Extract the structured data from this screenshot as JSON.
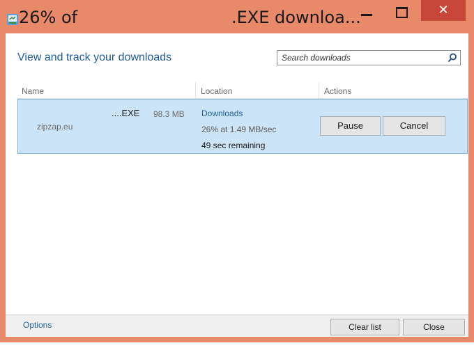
{
  "window": {
    "title_left": "26% of",
    "title_right": ".EXE downloa...",
    "close_glyph": "✕",
    "accent_color": "#e8896a",
    "close_color": "#c7483a"
  },
  "header": {
    "title": "View and track your downloads"
  },
  "search": {
    "placeholder": "Search downloads"
  },
  "columns": {
    "name": "Name",
    "location": "Location",
    "actions": "Actions"
  },
  "download": {
    "file_name": "....EXE",
    "size": "98.3 MB",
    "source": "zipzap.eu",
    "location": "Downloads",
    "progress_text": "26% at 1.49 MB/sec",
    "remaining": "49 sec remaining",
    "progress_percent": 26,
    "pause_label": "Pause",
    "cancel_label": "Cancel"
  },
  "footer": {
    "options_label": "Options",
    "clear_label": "Clear list",
    "close_label": "Close"
  },
  "icons": {
    "app": "downloads-app-icon",
    "search": "search-icon",
    "minimize": "minimize-icon",
    "maximize": "maximize-icon",
    "close": "close-icon"
  }
}
